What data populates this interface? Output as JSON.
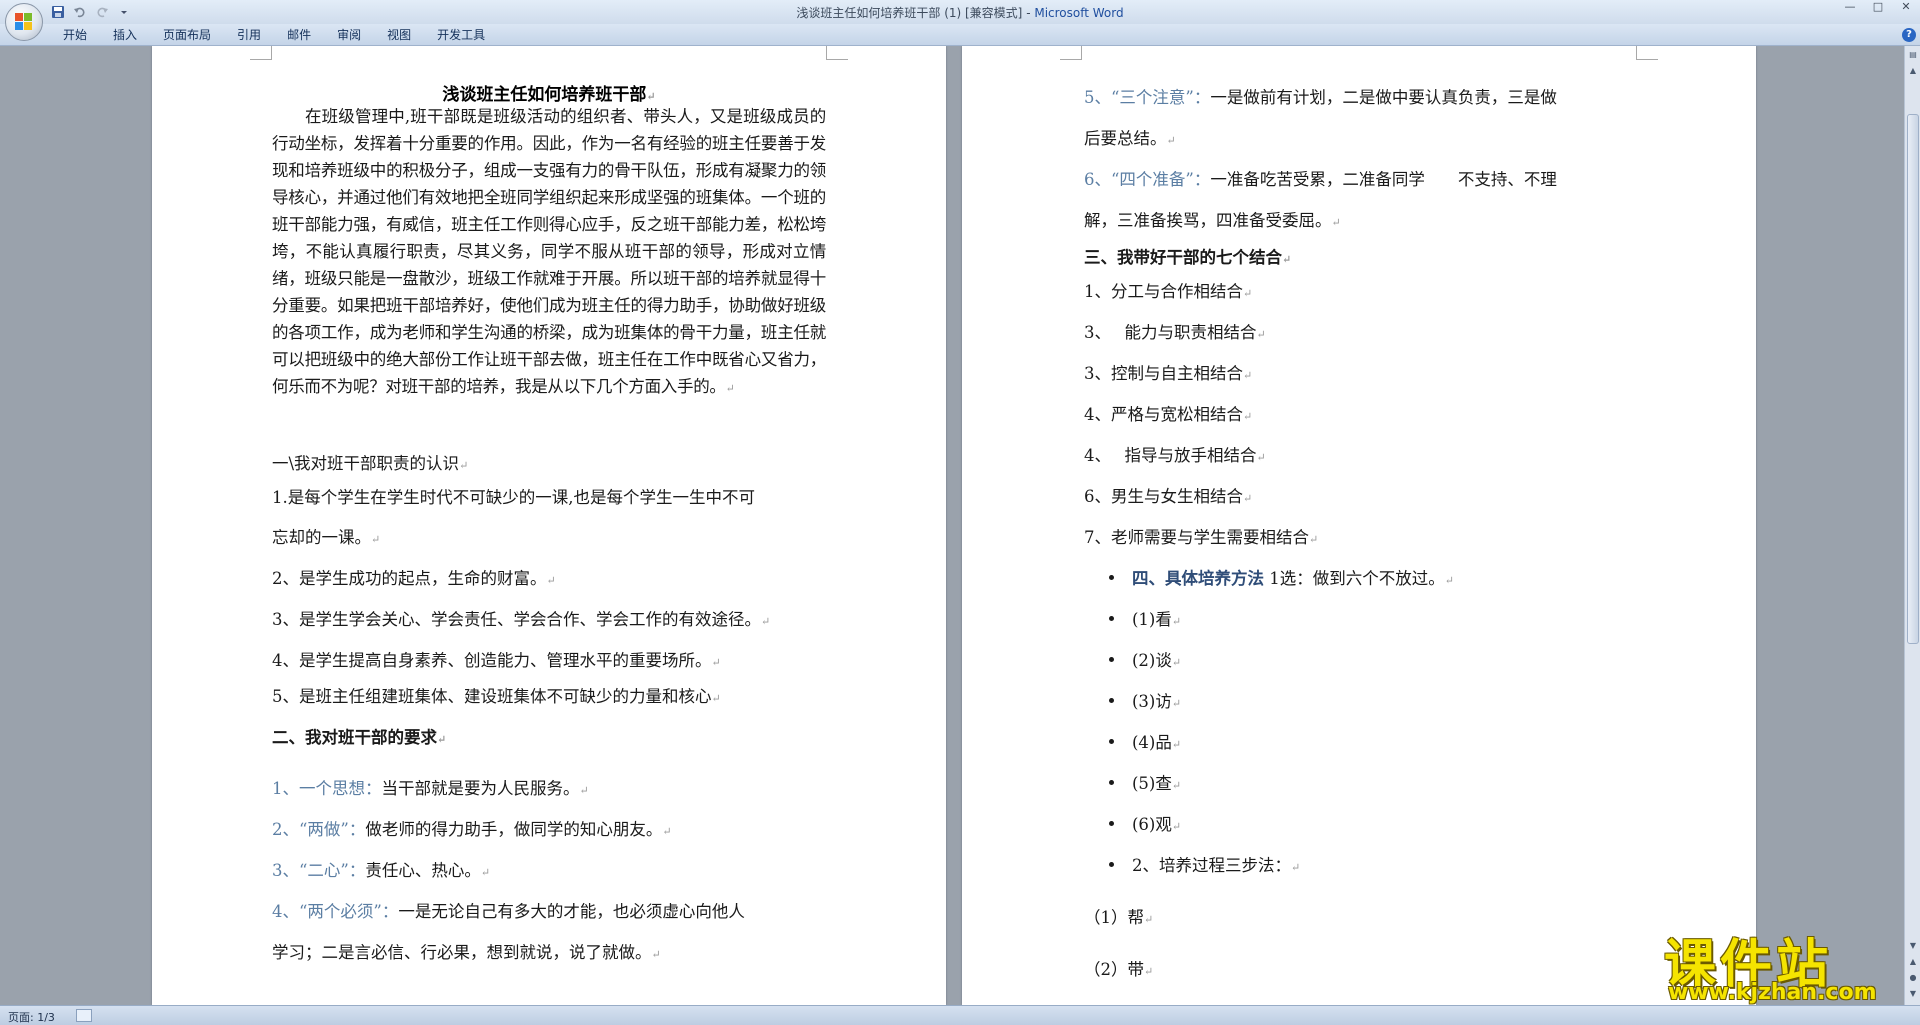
{
  "window": {
    "title_doc": "浅谈班主任如何培养班干部 (1) [兼容模式]",
    "title_sep": " - ",
    "title_app": "Microsoft Word",
    "controls": [
      "—",
      "□",
      "✕"
    ]
  },
  "quick_access": {
    "icons": [
      "save-icon",
      "undo-icon",
      "redo-icon",
      "customize-icon"
    ]
  },
  "ribbon": {
    "tabs": [
      "开始",
      "插入",
      "页面布局",
      "引用",
      "邮件",
      "审阅",
      "视图",
      "开发工具"
    ],
    "help": "?"
  },
  "page1": {
    "title": "浅谈班主任如何培养班干部",
    "intro": "在班级管理中,班干部既是班级活动的组织者、带头人，又是班级成员的行动坐标，发挥着十分重要的作用。因此，作为一名有经验的班主任要善于发现和培养班级中的积极分子，组成一支强有力的骨干队伍，形成有凝聚力的领导核心，并通过他们有效地把全班同学组织起来形成坚强的班集体。一个班的班干部能力强，有威信，班主任工作则得心应手，反之班干部能力差，松松垮垮，不能认真履行职责，尽其义务，同学不服从班干部的领导，形成对立情绪，班级只能是一盘散沙，班级工作就难于开展。所以班干部的培养就显得十分重要。如果把班干部培养好，使他们成为班主任的得力助手，协助做好班级的各项工作，成为老师和学生沟通的桥梁，成为班集体的骨干力量，班主任就可以把班级中的绝大部份工作让班干部去做，班主任在工作中既省心又省力，何乐而不为呢？对班干部的培养，我是从以下几个方面入手的。",
    "section1": "一\\我对班干部职责的认识",
    "item1_line1": "1.是每个学生在学生时代不可缺少的一课,也是每个学生一生中不可",
    "item1_line2": "忘却的一课。",
    "item2": "2、是学生成功的起点，生命的财富。",
    "item3": "3、是学生学会关心、学会责任、学会合作、学会工作的有效途径。",
    "item4": "4、是学生提高自身素养、创造能力、管理水平的重要场所。",
    "item5": "5、是班主任组建班集体、建设班集体不可缺少的力量和核心",
    "section2": "二、我对班干部的要求",
    "req1_label": "1、一个思想：",
    "req1_text": "当干部就是要为人民服务。",
    "req2_label": "2、“两做”：",
    "req2_text": "做老师的得力助手，做同学的知心朋友。",
    "req3_label": "3、“二心”：",
    "req3_text": "责任心、热心。",
    "req4_label": "4、“两个必须”：",
    "req4_text": "一是无论自己有多大的才能，也必须虚心向他人",
    "req4_line2": "学习；二是言必信、行必果，想到就说，说了就做。"
  },
  "page2": {
    "req5_label": "5、“三个注意”：",
    "req5_text": "一是做前有计划，二是做中要认真负责，三是做",
    "req5_line2": "后要总结。",
    "req6_label": "6、“四个准备”：",
    "req6_text": "一准备吃苦受累，二准备同学　　不支持、不理",
    "req6_line2": "解，三准备挨骂，四准备受委屈。",
    "section3": "三、我带好干部的七个结合",
    "c1": "1、分工与合作相结合",
    "c2": "3、　 能力与职责相结合",
    "c3": "3、控制与自主相结合",
    "c4": "4、严格与宽松相结合",
    "c5": "4、　 指导与放手相结合",
    "c6": "6、男生与女生相结合",
    "c7": "7、老师需要与学生需要相结合",
    "section4_label": "四、具体培养方法",
    "section4_text": "1选：做到六个不放过。",
    "b1": "(1)看",
    "b2": "(2)谈",
    "b3": "(3)访",
    "b4": "(4)品",
    "b5": "(5)查",
    "b6": "(6)观",
    "b7": "2、培养过程三步法：",
    "s1": "（1）帮",
    "s2": "（2）带"
  },
  "status": {
    "page": "页面: 1/3"
  },
  "watermark": {
    "big": "课件站",
    "url": "www.kjzhan.com"
  },
  "colors": {
    "heading_blue": "#2f4d78",
    "label_blue": "#5b7ea3",
    "watermark": "#f5e400"
  }
}
